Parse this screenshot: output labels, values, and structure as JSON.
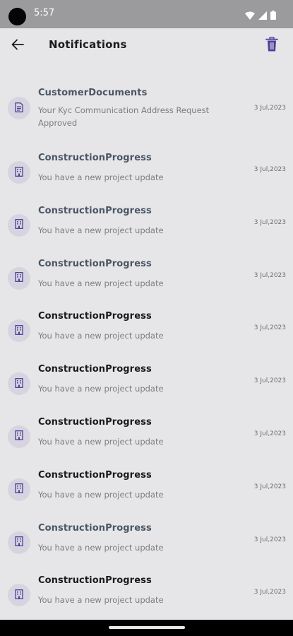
{
  "status_bar": {
    "time": "5:57"
  },
  "app_bar": {
    "title": "Notifications"
  },
  "notifications": [
    {
      "title": "CustomerDocuments",
      "body": "Your Kyc Communication Address Request Approved",
      "date": "3 Jul,2023",
      "icon": "document-icon",
      "read": true
    },
    {
      "title": "ConstructionProgress",
      "body": "You have a new project update",
      "date": "3 Jul,2023",
      "icon": "building-icon",
      "read": true
    },
    {
      "title": "ConstructionProgress",
      "body": "You have a new project update",
      "date": "3 Jul,2023",
      "icon": "building-icon",
      "read": true
    },
    {
      "title": "ConstructionProgress",
      "body": "You have a new project update",
      "date": "3 Jul,2023",
      "icon": "building-icon",
      "read": true
    },
    {
      "title": "ConstructionProgress",
      "body": "You have a new project update",
      "date": "3 Jul,2023",
      "icon": "building-icon",
      "read": false
    },
    {
      "title": "ConstructionProgress",
      "body": "You have a new project update",
      "date": "3 Jul,2023",
      "icon": "building-icon",
      "read": false
    },
    {
      "title": "ConstructionProgress",
      "body": "You have a new project update",
      "date": "3 Jul,2023",
      "icon": "building-icon",
      "read": false
    },
    {
      "title": "ConstructionProgress",
      "body": "You have a new project update",
      "date": "3 Jul,2023",
      "icon": "building-icon",
      "read": false
    },
    {
      "title": "ConstructionProgress",
      "body": "You have a new project update",
      "date": "3 Jul,2023",
      "icon": "building-icon",
      "read": true
    },
    {
      "title": "ConstructionProgress",
      "body": "You have a new project update",
      "date": "3 Jul,2023",
      "icon": "building-icon",
      "read": false
    }
  ],
  "colors": {
    "background": "#e6e6e9",
    "accent_icon": "#4a3f99",
    "read_title": "#4b5663",
    "unread_title": "#1a1a1c"
  }
}
